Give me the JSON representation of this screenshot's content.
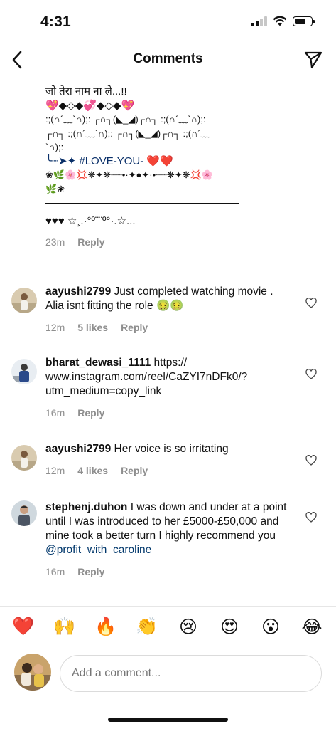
{
  "status_bar": {
    "time": "4:31"
  },
  "header": {
    "title": "Comments"
  },
  "caption": {
    "lines": [
      "जो तेरा नाम ना ले...!!",
      "💖◆◇◆💞◆◇◆💖",
      ":;(∩´﹏`∩);: ┌∩┐(◣_◢)┌∩┐ :;(∩´﹏`∩);:",
      " ┌∩┐ :;(∩´﹏`∩);: ┌∩┐(◣_◢)┌∩┐ :;(∩´﹏",
      "`∩);:",
      "╰┈➤✦ #LOVE-YOU- ❤️❤️",
      "❀🌿🌸💢❋✦❋┈┈•·✦●✦·•┈┈❋✦❋💢🌸",
      "🌿❀",
      "♥♥♥ ☆¸.·°º¨¨º°·.☆..."
    ],
    "time": "23m",
    "reply": "Reply"
  },
  "comments": [
    {
      "username": "aayushi2799",
      "text": "Just completed watching movie . Alia isnt fitting the role 🤢🤢",
      "time": "12m",
      "likes": "5 likes",
      "reply": "Reply"
    },
    {
      "username": "bharat_dewasi_1111",
      "text": "https://\nwww.instagram.com/reel/CaZYI7nDFk0/?\nutm_medium=copy_link",
      "time": "16m",
      "likes": "",
      "reply": "Reply"
    },
    {
      "username": "aayushi2799",
      "text": "Her voice is so irritating",
      "time": "12m",
      "likes": "4 likes",
      "reply": "Reply"
    },
    {
      "username": "stephenj.duhon",
      "text": "I was down and under at a point until I was introduced to her £5000-£50,000 and mine took a better turn I highly recommend you",
      "mention": "@profit_with_caroline",
      "time": "16m",
      "likes": "",
      "reply": "Reply"
    }
  ],
  "emoji_bar": [
    "❤️",
    "🙌",
    "🔥",
    "👏",
    "😢",
    "😍",
    "😮",
    "😂"
  ],
  "composer": {
    "placeholder": "Add a comment..."
  },
  "icons": {
    "back": "chevron-left-icon",
    "share": "paper-plane-icon",
    "like": "heart-outline-icon"
  }
}
